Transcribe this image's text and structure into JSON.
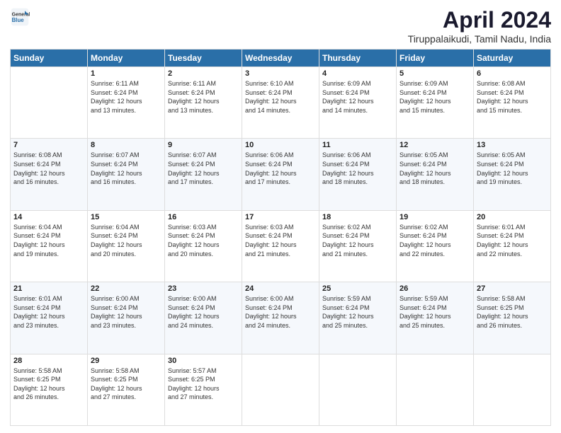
{
  "logo": {
    "general": "General",
    "blue": "Blue"
  },
  "title": "April 2024",
  "subtitle": "Tiruppalaikudi, Tamil Nadu, India",
  "days_of_week": [
    "Sunday",
    "Monday",
    "Tuesday",
    "Wednesday",
    "Thursday",
    "Friday",
    "Saturday"
  ],
  "weeks": [
    [
      {
        "day": "",
        "info": ""
      },
      {
        "day": "1",
        "info": "Sunrise: 6:11 AM\nSunset: 6:24 PM\nDaylight: 12 hours\nand 13 minutes."
      },
      {
        "day": "2",
        "info": "Sunrise: 6:11 AM\nSunset: 6:24 PM\nDaylight: 12 hours\nand 13 minutes."
      },
      {
        "day": "3",
        "info": "Sunrise: 6:10 AM\nSunset: 6:24 PM\nDaylight: 12 hours\nand 14 minutes."
      },
      {
        "day": "4",
        "info": "Sunrise: 6:09 AM\nSunset: 6:24 PM\nDaylight: 12 hours\nand 14 minutes."
      },
      {
        "day": "5",
        "info": "Sunrise: 6:09 AM\nSunset: 6:24 PM\nDaylight: 12 hours\nand 15 minutes."
      },
      {
        "day": "6",
        "info": "Sunrise: 6:08 AM\nSunset: 6:24 PM\nDaylight: 12 hours\nand 15 minutes."
      }
    ],
    [
      {
        "day": "7",
        "info": "Sunrise: 6:08 AM\nSunset: 6:24 PM\nDaylight: 12 hours\nand 16 minutes."
      },
      {
        "day": "8",
        "info": "Sunrise: 6:07 AM\nSunset: 6:24 PM\nDaylight: 12 hours\nand 16 minutes."
      },
      {
        "day": "9",
        "info": "Sunrise: 6:07 AM\nSunset: 6:24 PM\nDaylight: 12 hours\nand 17 minutes."
      },
      {
        "day": "10",
        "info": "Sunrise: 6:06 AM\nSunset: 6:24 PM\nDaylight: 12 hours\nand 17 minutes."
      },
      {
        "day": "11",
        "info": "Sunrise: 6:06 AM\nSunset: 6:24 PM\nDaylight: 12 hours\nand 18 minutes."
      },
      {
        "day": "12",
        "info": "Sunrise: 6:05 AM\nSunset: 6:24 PM\nDaylight: 12 hours\nand 18 minutes."
      },
      {
        "day": "13",
        "info": "Sunrise: 6:05 AM\nSunset: 6:24 PM\nDaylight: 12 hours\nand 19 minutes."
      }
    ],
    [
      {
        "day": "14",
        "info": "Sunrise: 6:04 AM\nSunset: 6:24 PM\nDaylight: 12 hours\nand 19 minutes."
      },
      {
        "day": "15",
        "info": "Sunrise: 6:04 AM\nSunset: 6:24 PM\nDaylight: 12 hours\nand 20 minutes."
      },
      {
        "day": "16",
        "info": "Sunrise: 6:03 AM\nSunset: 6:24 PM\nDaylight: 12 hours\nand 20 minutes."
      },
      {
        "day": "17",
        "info": "Sunrise: 6:03 AM\nSunset: 6:24 PM\nDaylight: 12 hours\nand 21 minutes."
      },
      {
        "day": "18",
        "info": "Sunrise: 6:02 AM\nSunset: 6:24 PM\nDaylight: 12 hours\nand 21 minutes."
      },
      {
        "day": "19",
        "info": "Sunrise: 6:02 AM\nSunset: 6:24 PM\nDaylight: 12 hours\nand 22 minutes."
      },
      {
        "day": "20",
        "info": "Sunrise: 6:01 AM\nSunset: 6:24 PM\nDaylight: 12 hours\nand 22 minutes."
      }
    ],
    [
      {
        "day": "21",
        "info": "Sunrise: 6:01 AM\nSunset: 6:24 PM\nDaylight: 12 hours\nand 23 minutes."
      },
      {
        "day": "22",
        "info": "Sunrise: 6:00 AM\nSunset: 6:24 PM\nDaylight: 12 hours\nand 23 minutes."
      },
      {
        "day": "23",
        "info": "Sunrise: 6:00 AM\nSunset: 6:24 PM\nDaylight: 12 hours\nand 24 minutes."
      },
      {
        "day": "24",
        "info": "Sunrise: 6:00 AM\nSunset: 6:24 PM\nDaylight: 12 hours\nand 24 minutes."
      },
      {
        "day": "25",
        "info": "Sunrise: 5:59 AM\nSunset: 6:24 PM\nDaylight: 12 hours\nand 25 minutes."
      },
      {
        "day": "26",
        "info": "Sunrise: 5:59 AM\nSunset: 6:24 PM\nDaylight: 12 hours\nand 25 minutes."
      },
      {
        "day": "27",
        "info": "Sunrise: 5:58 AM\nSunset: 6:25 PM\nDaylight: 12 hours\nand 26 minutes."
      }
    ],
    [
      {
        "day": "28",
        "info": "Sunrise: 5:58 AM\nSunset: 6:25 PM\nDaylight: 12 hours\nand 26 minutes."
      },
      {
        "day": "29",
        "info": "Sunrise: 5:58 AM\nSunset: 6:25 PM\nDaylight: 12 hours\nand 27 minutes."
      },
      {
        "day": "30",
        "info": "Sunrise: 5:57 AM\nSunset: 6:25 PM\nDaylight: 12 hours\nand 27 minutes."
      },
      {
        "day": "",
        "info": ""
      },
      {
        "day": "",
        "info": ""
      },
      {
        "day": "",
        "info": ""
      },
      {
        "day": "",
        "info": ""
      }
    ]
  ]
}
